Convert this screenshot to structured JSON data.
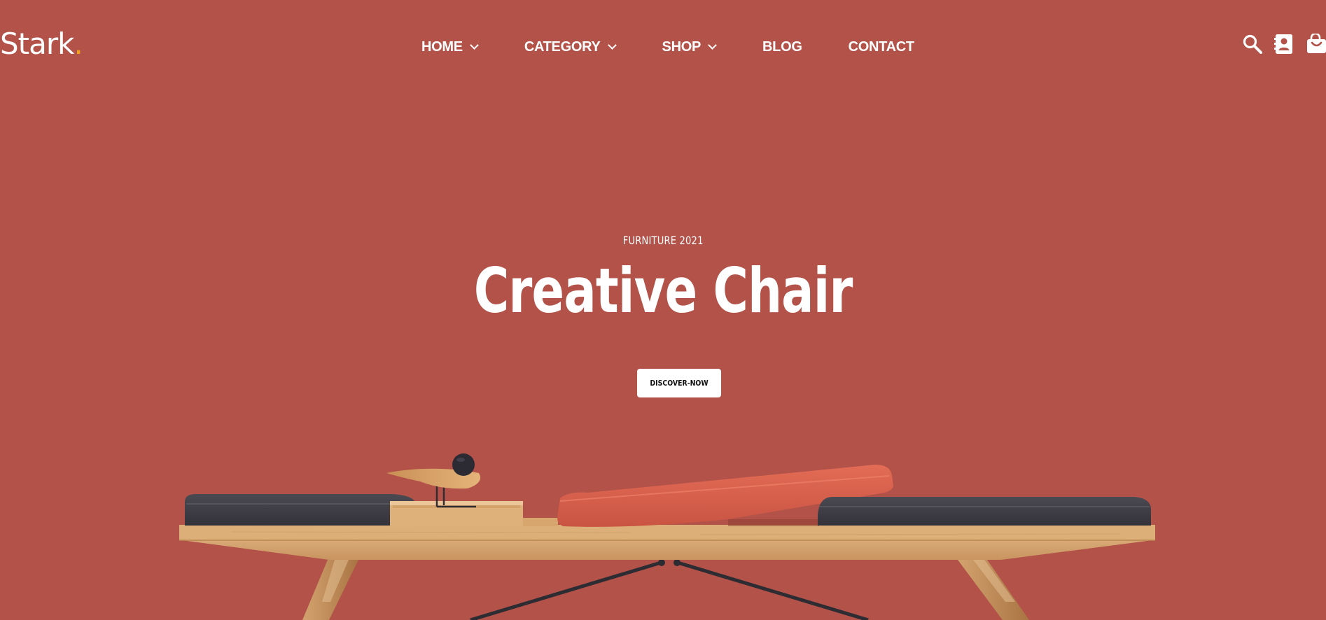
{
  "brand": {
    "name": "Stark",
    "dot": ".",
    "accent_color": "#f0a21a"
  },
  "theme": {
    "background": "#b35249",
    "text": "#ffffff"
  },
  "nav": {
    "items": [
      {
        "label": "HOME",
        "has_dropdown": true
      },
      {
        "label": "CATEGORY",
        "has_dropdown": true
      },
      {
        "label": "SHOP",
        "has_dropdown": true
      },
      {
        "label": "BLOG",
        "has_dropdown": false
      },
      {
        "label": "CONTACT",
        "has_dropdown": false
      }
    ]
  },
  "header_icons": [
    "search-icon",
    "contact-book-icon",
    "shopping-bag-icon"
  ],
  "hero": {
    "eyebrow": "FURNITURE 2021",
    "title": "Creative Chair",
    "cta_label": "DISCOVER-NOW",
    "image": "bench-with-cushions-and-wooden-bird"
  }
}
